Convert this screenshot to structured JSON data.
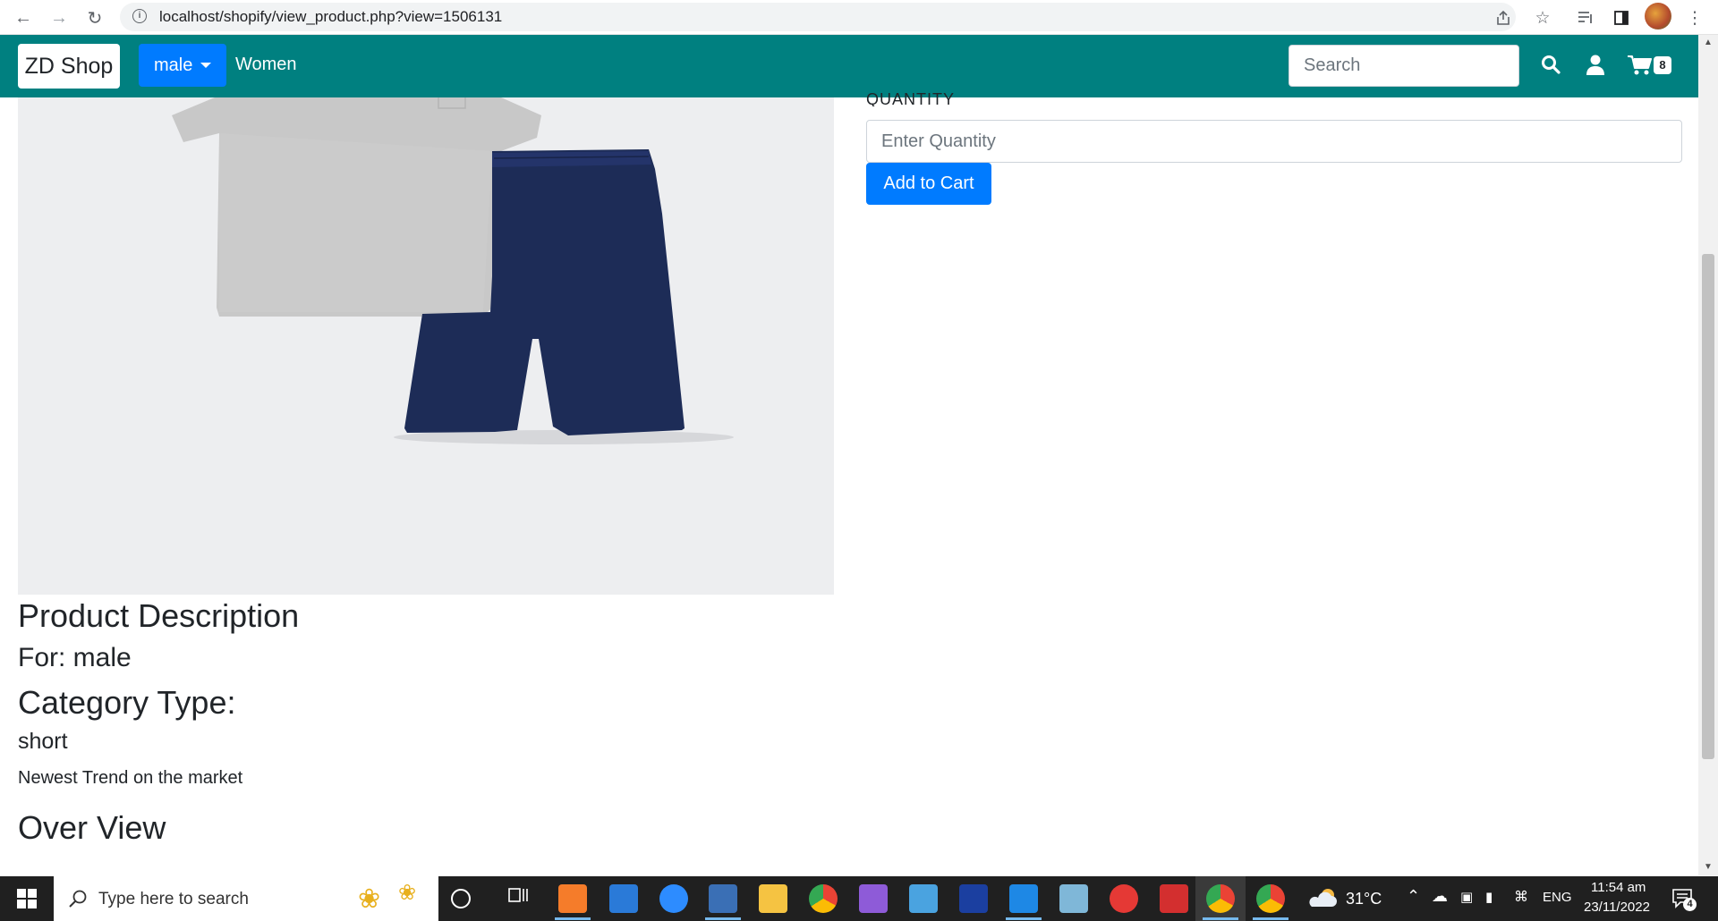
{
  "browser": {
    "url": "localhost/shopify/view_product.php?view=1506131"
  },
  "navbar": {
    "brand": "ZD Shop",
    "dropdown_label": "male",
    "link_women": "Women",
    "search_placeholder": "Search",
    "cart_count": "8"
  },
  "product": {
    "quantity_label": "QUANTITY",
    "quantity_placeholder": "Enter Quantity",
    "add_to_cart_label": "Add to Cart",
    "description_heading": "Product Description",
    "for_text": "For: male",
    "category_heading": "Category Type:",
    "category_value": "short",
    "description_text": "Newest Trend on the market",
    "overview_heading": "Over View"
  },
  "taskbar": {
    "search_placeholder": "Type here to search",
    "weather": "31°C",
    "language": "ENG",
    "time": "11:54 am",
    "date": "23/11/2022",
    "notification_count": "4"
  },
  "colors": {
    "navbar_bg": "#008080",
    "primary_button": "#007bff"
  }
}
